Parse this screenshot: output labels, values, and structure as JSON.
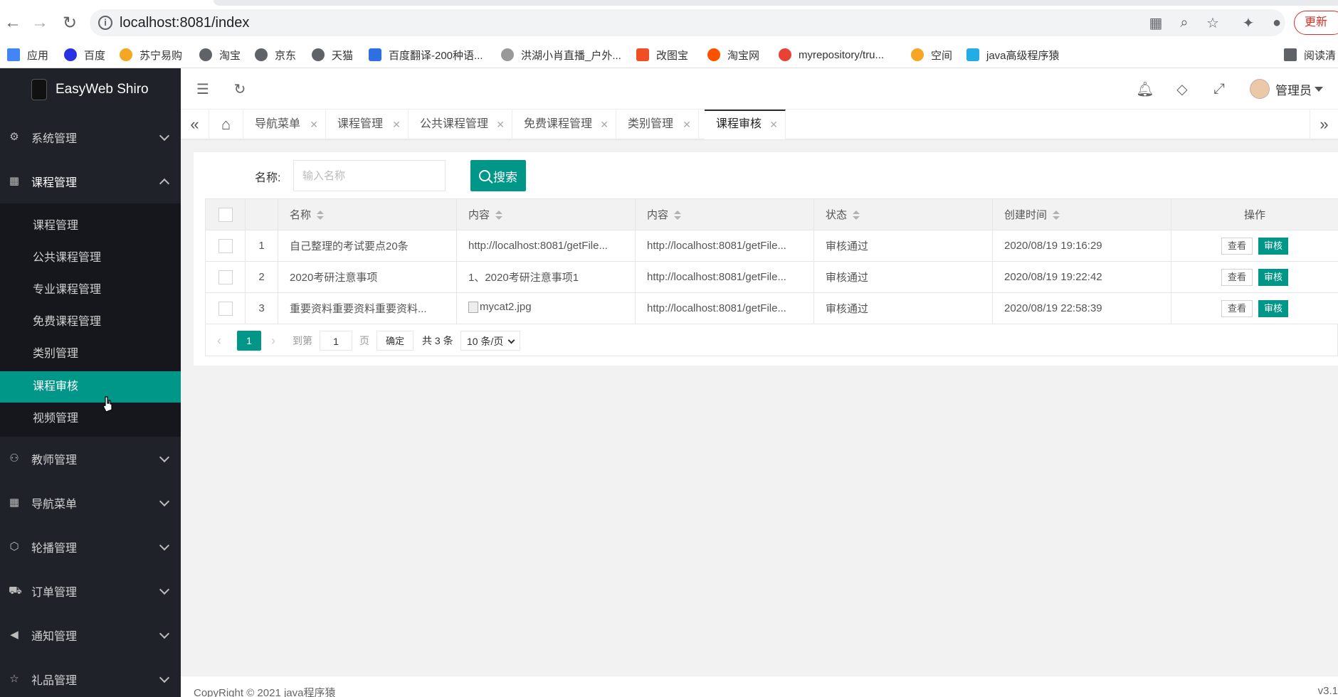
{
  "browser": {
    "url": "localhost:8081/index",
    "update_label": "更新",
    "bookmarks": [
      {
        "label": "应用",
        "color": "#4285f4"
      },
      {
        "label": "百度",
        "color": "#2932e1"
      },
      {
        "label": "苏宁易购",
        "color": "#f5a623"
      },
      {
        "label": "淘宝",
        "color": "#5f6368"
      },
      {
        "label": "京东",
        "color": "#5f6368"
      },
      {
        "label": "天猫",
        "color": "#5f6368"
      },
      {
        "label": "百度翻译-200种语...",
        "color": "#2f6fe4"
      },
      {
        "label": "洪湖小肖直播_户外...",
        "color": "#999999"
      },
      {
        "label": "改图宝",
        "color": "#f04e23"
      },
      {
        "label": "淘宝网",
        "color": "#ff5000"
      },
      {
        "label": "myrepository/tru...",
        "color": "#e94235"
      },
      {
        "label": "空间",
        "color": "#f5a623"
      },
      {
        "label": "java高级程序猿",
        "color": "#23ade5"
      },
      {
        "label": "阅读清",
        "color": "#5f6368"
      }
    ]
  },
  "app": {
    "logo_text": "EasyWeb Shiro",
    "user_name": "管理员",
    "footer_copy": "CopyRight © 2021 java程序猿",
    "footer_version": "v3.1"
  },
  "sidebar": {
    "groups": [
      {
        "label": "系统管理",
        "icon": "gear-icon"
      },
      {
        "label": "课程管理",
        "icon": "apps-icon"
      },
      {
        "label": "教师管理",
        "icon": "user-icon"
      },
      {
        "label": "导航菜单",
        "icon": "apps-icon"
      },
      {
        "label": "轮播管理",
        "icon": "cube-icon"
      },
      {
        "label": "订单管理",
        "icon": "cart-icon"
      },
      {
        "label": "通知管理",
        "icon": "speaker-icon"
      },
      {
        "label": "礼品管理",
        "icon": "star-icon"
      }
    ],
    "course_items": [
      "课程管理",
      "公共课程管理",
      "专业课程管理",
      "免费课程管理",
      "类别管理",
      "课程审核",
      "视频管理"
    ]
  },
  "tabs": [
    "导航菜单",
    "课程管理",
    "公共课程管理",
    "免费课程管理",
    "类别管理",
    "课程审核"
  ],
  "search": {
    "label": "名称:",
    "placeholder": "输入名称",
    "button": "搜索"
  },
  "table": {
    "headers": [
      "名称",
      "内容",
      "内容",
      "状态",
      "创建时间",
      "操作"
    ],
    "rows": [
      {
        "index": "1",
        "name": "自己整理的考试要点20条",
        "content": "http://localhost:8081/getFile...",
        "content2": "http://localhost:8081/getFile...",
        "status": "审核通过",
        "created": "2020/08/19 19:16:29"
      },
      {
        "index": "2",
        "name": "2020考研注意事项",
        "content": "1、2020考研注意事项1",
        "content2": "http://localhost:8081/getFile...",
        "status": "审核通过",
        "created": "2020/08/19 19:22:42"
      },
      {
        "index": "3",
        "name": "重要资料重要资料重要资料...",
        "content": "mycat2.jpg",
        "content2": "http://localhost:8081/getFile...",
        "status": "审核通过",
        "created": "2020/08/19 22:58:39"
      }
    ],
    "view_label": "查看",
    "audit_label": "审核"
  },
  "pager": {
    "current": "1",
    "goto_label": "到第",
    "goto_value": "1",
    "page_label": "页",
    "confirm": "确定",
    "total": "共 3 条",
    "page_size": "10 条/页"
  },
  "colors": {
    "accent": "#009688",
    "sidebar": "#20222a"
  }
}
